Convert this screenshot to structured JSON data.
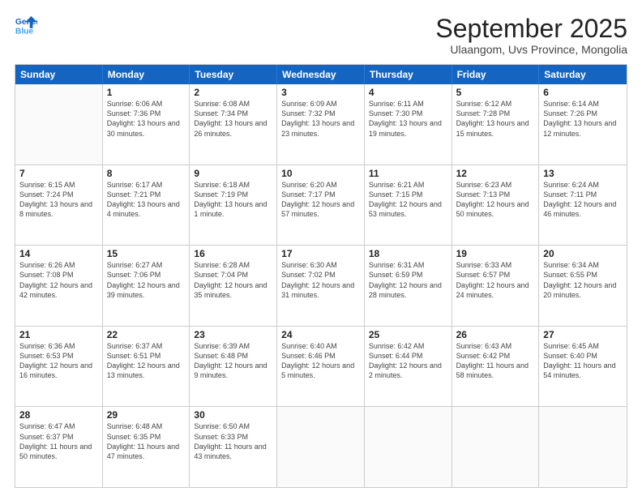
{
  "logo": {
    "line1": "General",
    "line2": "Blue"
  },
  "title": "September 2025",
  "subtitle": "Ulaangom, Uvs Province, Mongolia",
  "header_days": [
    "Sunday",
    "Monday",
    "Tuesday",
    "Wednesday",
    "Thursday",
    "Friday",
    "Saturday"
  ],
  "rows": [
    [
      {
        "day": "",
        "sunrise": "",
        "sunset": "",
        "daylight": ""
      },
      {
        "day": "1",
        "sunrise": "Sunrise: 6:06 AM",
        "sunset": "Sunset: 7:36 PM",
        "daylight": "Daylight: 13 hours and 30 minutes."
      },
      {
        "day": "2",
        "sunrise": "Sunrise: 6:08 AM",
        "sunset": "Sunset: 7:34 PM",
        "daylight": "Daylight: 13 hours and 26 minutes."
      },
      {
        "day": "3",
        "sunrise": "Sunrise: 6:09 AM",
        "sunset": "Sunset: 7:32 PM",
        "daylight": "Daylight: 13 hours and 23 minutes."
      },
      {
        "day": "4",
        "sunrise": "Sunrise: 6:11 AM",
        "sunset": "Sunset: 7:30 PM",
        "daylight": "Daylight: 13 hours and 19 minutes."
      },
      {
        "day": "5",
        "sunrise": "Sunrise: 6:12 AM",
        "sunset": "Sunset: 7:28 PM",
        "daylight": "Daylight: 13 hours and 15 minutes."
      },
      {
        "day": "6",
        "sunrise": "Sunrise: 6:14 AM",
        "sunset": "Sunset: 7:26 PM",
        "daylight": "Daylight: 13 hours and 12 minutes."
      }
    ],
    [
      {
        "day": "7",
        "sunrise": "Sunrise: 6:15 AM",
        "sunset": "Sunset: 7:24 PM",
        "daylight": "Daylight: 13 hours and 8 minutes."
      },
      {
        "day": "8",
        "sunrise": "Sunrise: 6:17 AM",
        "sunset": "Sunset: 7:21 PM",
        "daylight": "Daylight: 13 hours and 4 minutes."
      },
      {
        "day": "9",
        "sunrise": "Sunrise: 6:18 AM",
        "sunset": "Sunset: 7:19 PM",
        "daylight": "Daylight: 13 hours and 1 minute."
      },
      {
        "day": "10",
        "sunrise": "Sunrise: 6:20 AM",
        "sunset": "Sunset: 7:17 PM",
        "daylight": "Daylight: 12 hours and 57 minutes."
      },
      {
        "day": "11",
        "sunrise": "Sunrise: 6:21 AM",
        "sunset": "Sunset: 7:15 PM",
        "daylight": "Daylight: 12 hours and 53 minutes."
      },
      {
        "day": "12",
        "sunrise": "Sunrise: 6:23 AM",
        "sunset": "Sunset: 7:13 PM",
        "daylight": "Daylight: 12 hours and 50 minutes."
      },
      {
        "day": "13",
        "sunrise": "Sunrise: 6:24 AM",
        "sunset": "Sunset: 7:11 PM",
        "daylight": "Daylight: 12 hours and 46 minutes."
      }
    ],
    [
      {
        "day": "14",
        "sunrise": "Sunrise: 6:26 AM",
        "sunset": "Sunset: 7:08 PM",
        "daylight": "Daylight: 12 hours and 42 minutes."
      },
      {
        "day": "15",
        "sunrise": "Sunrise: 6:27 AM",
        "sunset": "Sunset: 7:06 PM",
        "daylight": "Daylight: 12 hours and 39 minutes."
      },
      {
        "day": "16",
        "sunrise": "Sunrise: 6:28 AM",
        "sunset": "Sunset: 7:04 PM",
        "daylight": "Daylight: 12 hours and 35 minutes."
      },
      {
        "day": "17",
        "sunrise": "Sunrise: 6:30 AM",
        "sunset": "Sunset: 7:02 PM",
        "daylight": "Daylight: 12 hours and 31 minutes."
      },
      {
        "day": "18",
        "sunrise": "Sunrise: 6:31 AM",
        "sunset": "Sunset: 6:59 PM",
        "daylight": "Daylight: 12 hours and 28 minutes."
      },
      {
        "day": "19",
        "sunrise": "Sunrise: 6:33 AM",
        "sunset": "Sunset: 6:57 PM",
        "daylight": "Daylight: 12 hours and 24 minutes."
      },
      {
        "day": "20",
        "sunrise": "Sunrise: 6:34 AM",
        "sunset": "Sunset: 6:55 PM",
        "daylight": "Daylight: 12 hours and 20 minutes."
      }
    ],
    [
      {
        "day": "21",
        "sunrise": "Sunrise: 6:36 AM",
        "sunset": "Sunset: 6:53 PM",
        "daylight": "Daylight: 12 hours and 16 minutes."
      },
      {
        "day": "22",
        "sunrise": "Sunrise: 6:37 AM",
        "sunset": "Sunset: 6:51 PM",
        "daylight": "Daylight: 12 hours and 13 minutes."
      },
      {
        "day": "23",
        "sunrise": "Sunrise: 6:39 AM",
        "sunset": "Sunset: 6:48 PM",
        "daylight": "Daylight: 12 hours and 9 minutes."
      },
      {
        "day": "24",
        "sunrise": "Sunrise: 6:40 AM",
        "sunset": "Sunset: 6:46 PM",
        "daylight": "Daylight: 12 hours and 5 minutes."
      },
      {
        "day": "25",
        "sunrise": "Sunrise: 6:42 AM",
        "sunset": "Sunset: 6:44 PM",
        "daylight": "Daylight: 12 hours and 2 minutes."
      },
      {
        "day": "26",
        "sunrise": "Sunrise: 6:43 AM",
        "sunset": "Sunset: 6:42 PM",
        "daylight": "Daylight: 11 hours and 58 minutes."
      },
      {
        "day": "27",
        "sunrise": "Sunrise: 6:45 AM",
        "sunset": "Sunset: 6:40 PM",
        "daylight": "Daylight: 11 hours and 54 minutes."
      }
    ],
    [
      {
        "day": "28",
        "sunrise": "Sunrise: 6:47 AM",
        "sunset": "Sunset: 6:37 PM",
        "daylight": "Daylight: 11 hours and 50 minutes."
      },
      {
        "day": "29",
        "sunrise": "Sunrise: 6:48 AM",
        "sunset": "Sunset: 6:35 PM",
        "daylight": "Daylight: 11 hours and 47 minutes."
      },
      {
        "day": "30",
        "sunrise": "Sunrise: 6:50 AM",
        "sunset": "Sunset: 6:33 PM",
        "daylight": "Daylight: 11 hours and 43 minutes."
      },
      {
        "day": "",
        "sunrise": "",
        "sunset": "",
        "daylight": ""
      },
      {
        "day": "",
        "sunrise": "",
        "sunset": "",
        "daylight": ""
      },
      {
        "day": "",
        "sunrise": "",
        "sunset": "",
        "daylight": ""
      },
      {
        "day": "",
        "sunrise": "",
        "sunset": "",
        "daylight": ""
      }
    ]
  ]
}
